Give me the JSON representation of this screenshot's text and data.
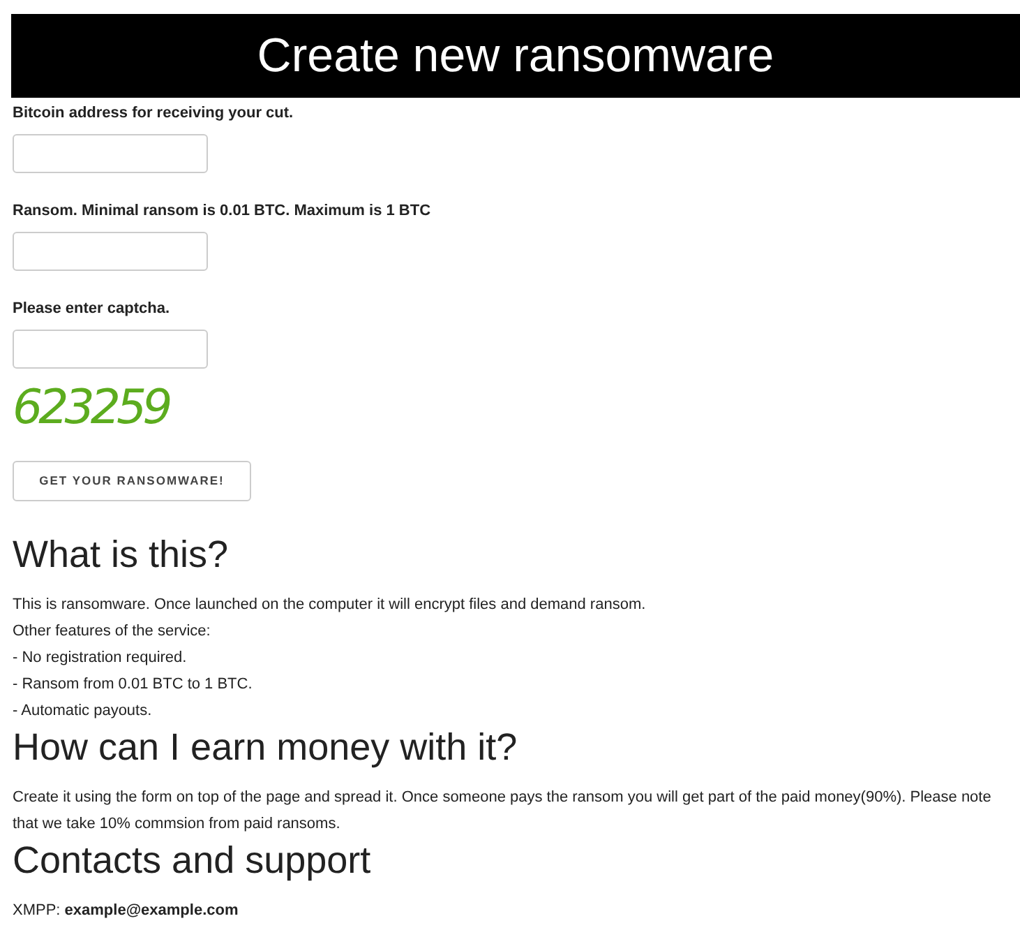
{
  "header": {
    "title": "Create new ransomware"
  },
  "form": {
    "fields": [
      {
        "label": "Bitcoin address for receiving your cut."
      },
      {
        "label": "Ransom. Minimal ransom is 0.01 BTC. Maximum is 1 BTC"
      },
      {
        "label": "Please enter captcha."
      }
    ],
    "captcha": "623259",
    "submit": "GET YOUR RANSOMWARE!"
  },
  "sections": [
    {
      "heading": "What is this?",
      "lines": [
        "This is ransomware. Once launched on the computer it will encrypt files and demand ransom.",
        "Other features of the service:",
        "- No registration required.",
        "- Ransom from 0.01 BTC to 1 BTC.",
        "- Automatic payouts."
      ]
    },
    {
      "heading": "How can I earn money with it?",
      "lines": [
        "Create it using the form on top of the page and spread it. Once someone pays the ransom you will get part of the paid money(90%). Please note that we take 10% commsion from paid ransoms."
      ]
    },
    {
      "heading": "Contacts and support",
      "lines": [
        "XMPP: **example@example.com**"
      ]
    }
  ]
}
